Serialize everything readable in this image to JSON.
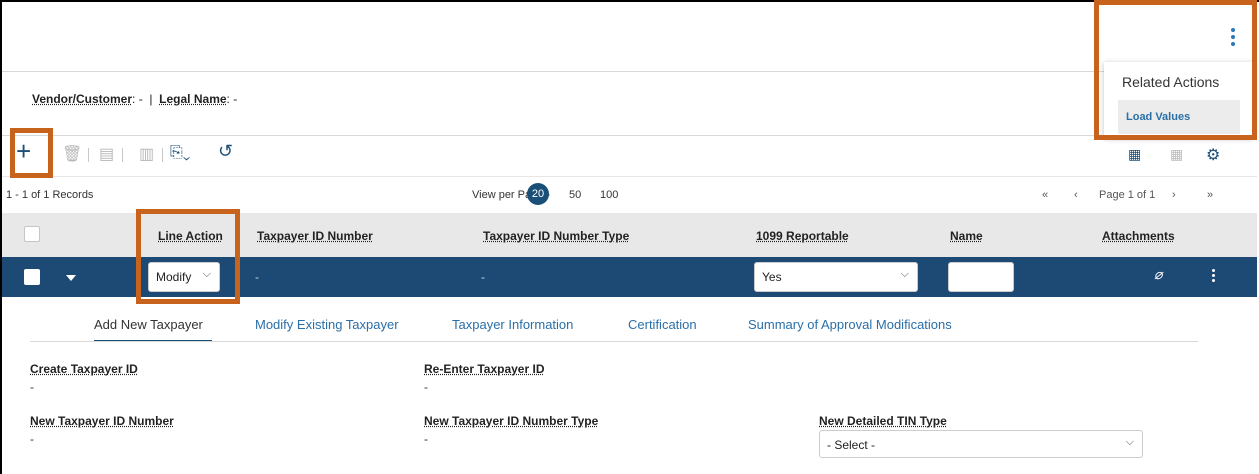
{
  "vendor": {
    "vendor_label": "Vendor/Customer",
    "vendor_value": "-",
    "sep": "|",
    "legal_label": "Legal Name",
    "legal_value": "-"
  },
  "toolbar": {
    "add_icon": "plus-icon",
    "delete_icon": "trash-icon",
    "copy_icon": "copy-icon",
    "paste_icon": "paste-icon",
    "export_icon": "export-icon",
    "refresh_icon": "refresh-icon"
  },
  "records": {
    "count": "1 - 1 of 1 Records",
    "view_per_page_label": "View per Page -",
    "options": [
      "20",
      "50",
      "100"
    ],
    "selected": "20",
    "page_label": "Page 1 of 1",
    "first": "«",
    "prev": "‹",
    "next": "›",
    "last": "»"
  },
  "table": {
    "headers": [
      "Line Action",
      "Taxpayer ID Number",
      "Taxpayer ID Number Type",
      "1099 Reportable",
      "Name",
      "Attachments"
    ],
    "row": {
      "line_action": "Modify",
      "taxpayer_id": "-",
      "taxpayer_id_type": "-",
      "reportable": "Yes",
      "name": ""
    }
  },
  "tabs": [
    "Add New Taxpayer",
    "Modify Existing Taxpayer",
    "Taxpayer Information",
    "Certification",
    "Summary of Approval Modifications"
  ],
  "form": {
    "create_id_label": "Create Taxpayer ID",
    "create_id_value": "-",
    "reenter_id_label": "Re-Enter Taxpayer ID",
    "reenter_id_value": "-",
    "new_id_label": "New Taxpayer ID Number",
    "new_id_value": "-",
    "new_id_type_label": "New Taxpayer ID Number Type",
    "new_id_type_value": "-",
    "tin_type_label": "New Detailed TIN Type",
    "tin_type_value": "- Select -"
  },
  "popup": {
    "title": "Related Actions",
    "item": "Load Values"
  },
  "colors": {
    "accent": "#1d4a74",
    "link": "#2a6fa8",
    "highlight": "#c8631e"
  }
}
